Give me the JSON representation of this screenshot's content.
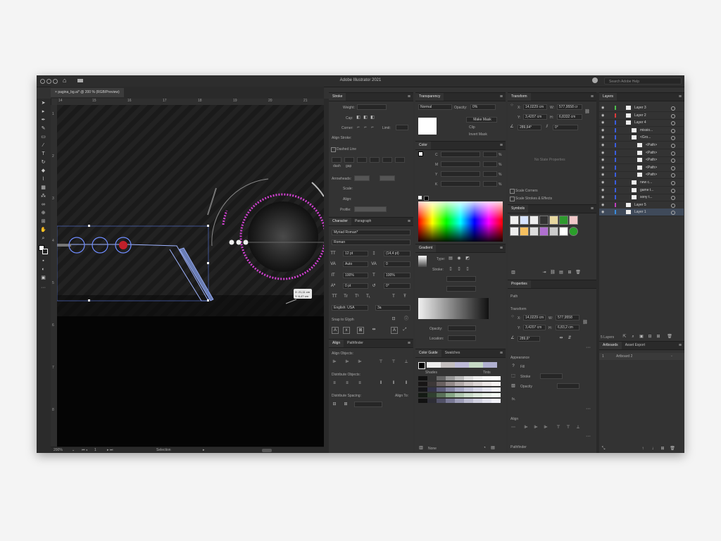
{
  "app": {
    "title": "Adobe Illustrator 2021",
    "search_placeholder": "Search Adobe Help"
  },
  "document": {
    "tab_label": "pagina_bg.ai* @ 200 % (RGB/Preview)"
  },
  "rulers": {
    "h": [
      "14",
      "15",
      "16",
      "17",
      "18",
      "19",
      "20",
      "21"
    ],
    "v": [
      "1",
      "2",
      "3",
      "4",
      "5",
      "6",
      "7",
      "8"
    ]
  },
  "status": {
    "zoom": "200%",
    "artboard": "1",
    "mode": "Selection"
  },
  "canvas": {
    "tooltip_line1": "X: 21,11 cm",
    "tooltip_line2": "Y: 6,47 cm"
  },
  "stroke": {
    "tab": "Stroke",
    "weight": "Weight:",
    "cap": "Cap:",
    "corner": "Corner:",
    "limit": "Limit:",
    "align": "Align Stroke:",
    "dashed": "Dashed Line",
    "dash": "dash",
    "gap": "gap",
    "arrowheads": "Arrowheads:",
    "scale": "Scale:",
    "align2": "Align:",
    "profile": "Profile:"
  },
  "character": {
    "tab": "Character",
    "tab2": "Paragraph",
    "font": "Myriad Roman*",
    "style": "Roman",
    "size": "12 pt",
    "leading": "(14,4 pt)",
    "kerning": "Auto",
    "tracking": "0",
    "vscale": "100%",
    "hscale": "100%",
    "baseline": "0 pt",
    "rotation": "0°",
    "language": "English: USA",
    "aa": "3a",
    "snap": "Snap to Glyph"
  },
  "align": {
    "tab": "Align",
    "tab2": "Pathfinder",
    "objects": "Align Objects:",
    "distribute": "Distribute Objects:",
    "spacing": "Distribute Spacing:",
    "align_to": "Align To:"
  },
  "transparency": {
    "tab": "Transparency",
    "mode": "Normal",
    "opacity_label": "Opacity:",
    "opacity": "0%",
    "make_mask": "Make Mask",
    "clip": "Clip",
    "invert": "Invert Mask"
  },
  "color": {
    "tab": "Color",
    "channels": [
      "C",
      "M",
      "Y",
      "K"
    ],
    "pct": "%"
  },
  "gradient": {
    "tab": "Gradient",
    "type": "Type:",
    "stroke": "Stroke:",
    "opacity": "Opacity:",
    "location": "Location:"
  },
  "colorguide": {
    "tab": "Color Guide",
    "tab2": "Swatches",
    "shades": "Shades",
    "tints": "Tints",
    "none": "None"
  },
  "transform": {
    "tab": "Transform",
    "x": "14,0229 cm",
    "y": "3,4207 cm",
    "w": "577,9558 cr",
    "h": "6,8332 cm",
    "angle": "289,64°",
    "shear": "0°",
    "no_state": "No State Properties",
    "scale_corners": "Scale Corners",
    "scale_strokes": "Scale Strokes & Effects"
  },
  "symbols": {
    "tab": "Symbols"
  },
  "properties": {
    "tab": "Properties",
    "path": "Path",
    "transform": "Transform",
    "x": "14,0229 cm",
    "y": "3,4207 cm",
    "w": "577,9558",
    "h": "6,83,2 cm",
    "angle": "289,6°",
    "appearance": "Appearance",
    "fill": "Fill",
    "stroke": "Stroke",
    "opacity": "Opacity",
    "fx": "fx.",
    "align": "Align",
    "pathfinder": "Pathfinder"
  },
  "layers": {
    "tab": "Layers",
    "rows": [
      {
        "name": "Layer 3",
        "color": "#4ec24e"
      },
      {
        "name": "Layer 2",
        "color": "#e03a3a"
      },
      {
        "name": "Layer 4",
        "color": "#3a5ee0"
      },
      {
        "name": "missio...",
        "color": "#3a5ee0"
      },
      {
        "name": "<Gro...",
        "color": "#3a5ee0"
      },
      {
        "name": "<Path>",
        "color": "#3a5ee0"
      },
      {
        "name": "<Path>",
        "color": "#3a5ee0"
      },
      {
        "name": "<Path>",
        "color": "#3a5ee0"
      },
      {
        "name": "<Path>",
        "color": "#3a5ee0"
      },
      {
        "name": "<Path>",
        "color": "#3a5ee0"
      },
      {
        "name": "new c...",
        "color": "#3a5ee0"
      },
      {
        "name": "game t...",
        "color": "#3a5ee0"
      },
      {
        "name": "sony t...",
        "color": "#3a5ee0"
      },
      {
        "name": "Layer 5",
        "color": "#c040c0"
      },
      {
        "name": "Layer 1",
        "color": "#3a8ee0"
      }
    ],
    "count": "5 Layers"
  },
  "artboards": {
    "tab": "Artboards",
    "tab2": "Asset Export",
    "num": "1",
    "name": "Artboard 2"
  },
  "colors": {
    "accent": "#3a8ee0",
    "magenta": "#d040d0",
    "bg": "#323232"
  }
}
